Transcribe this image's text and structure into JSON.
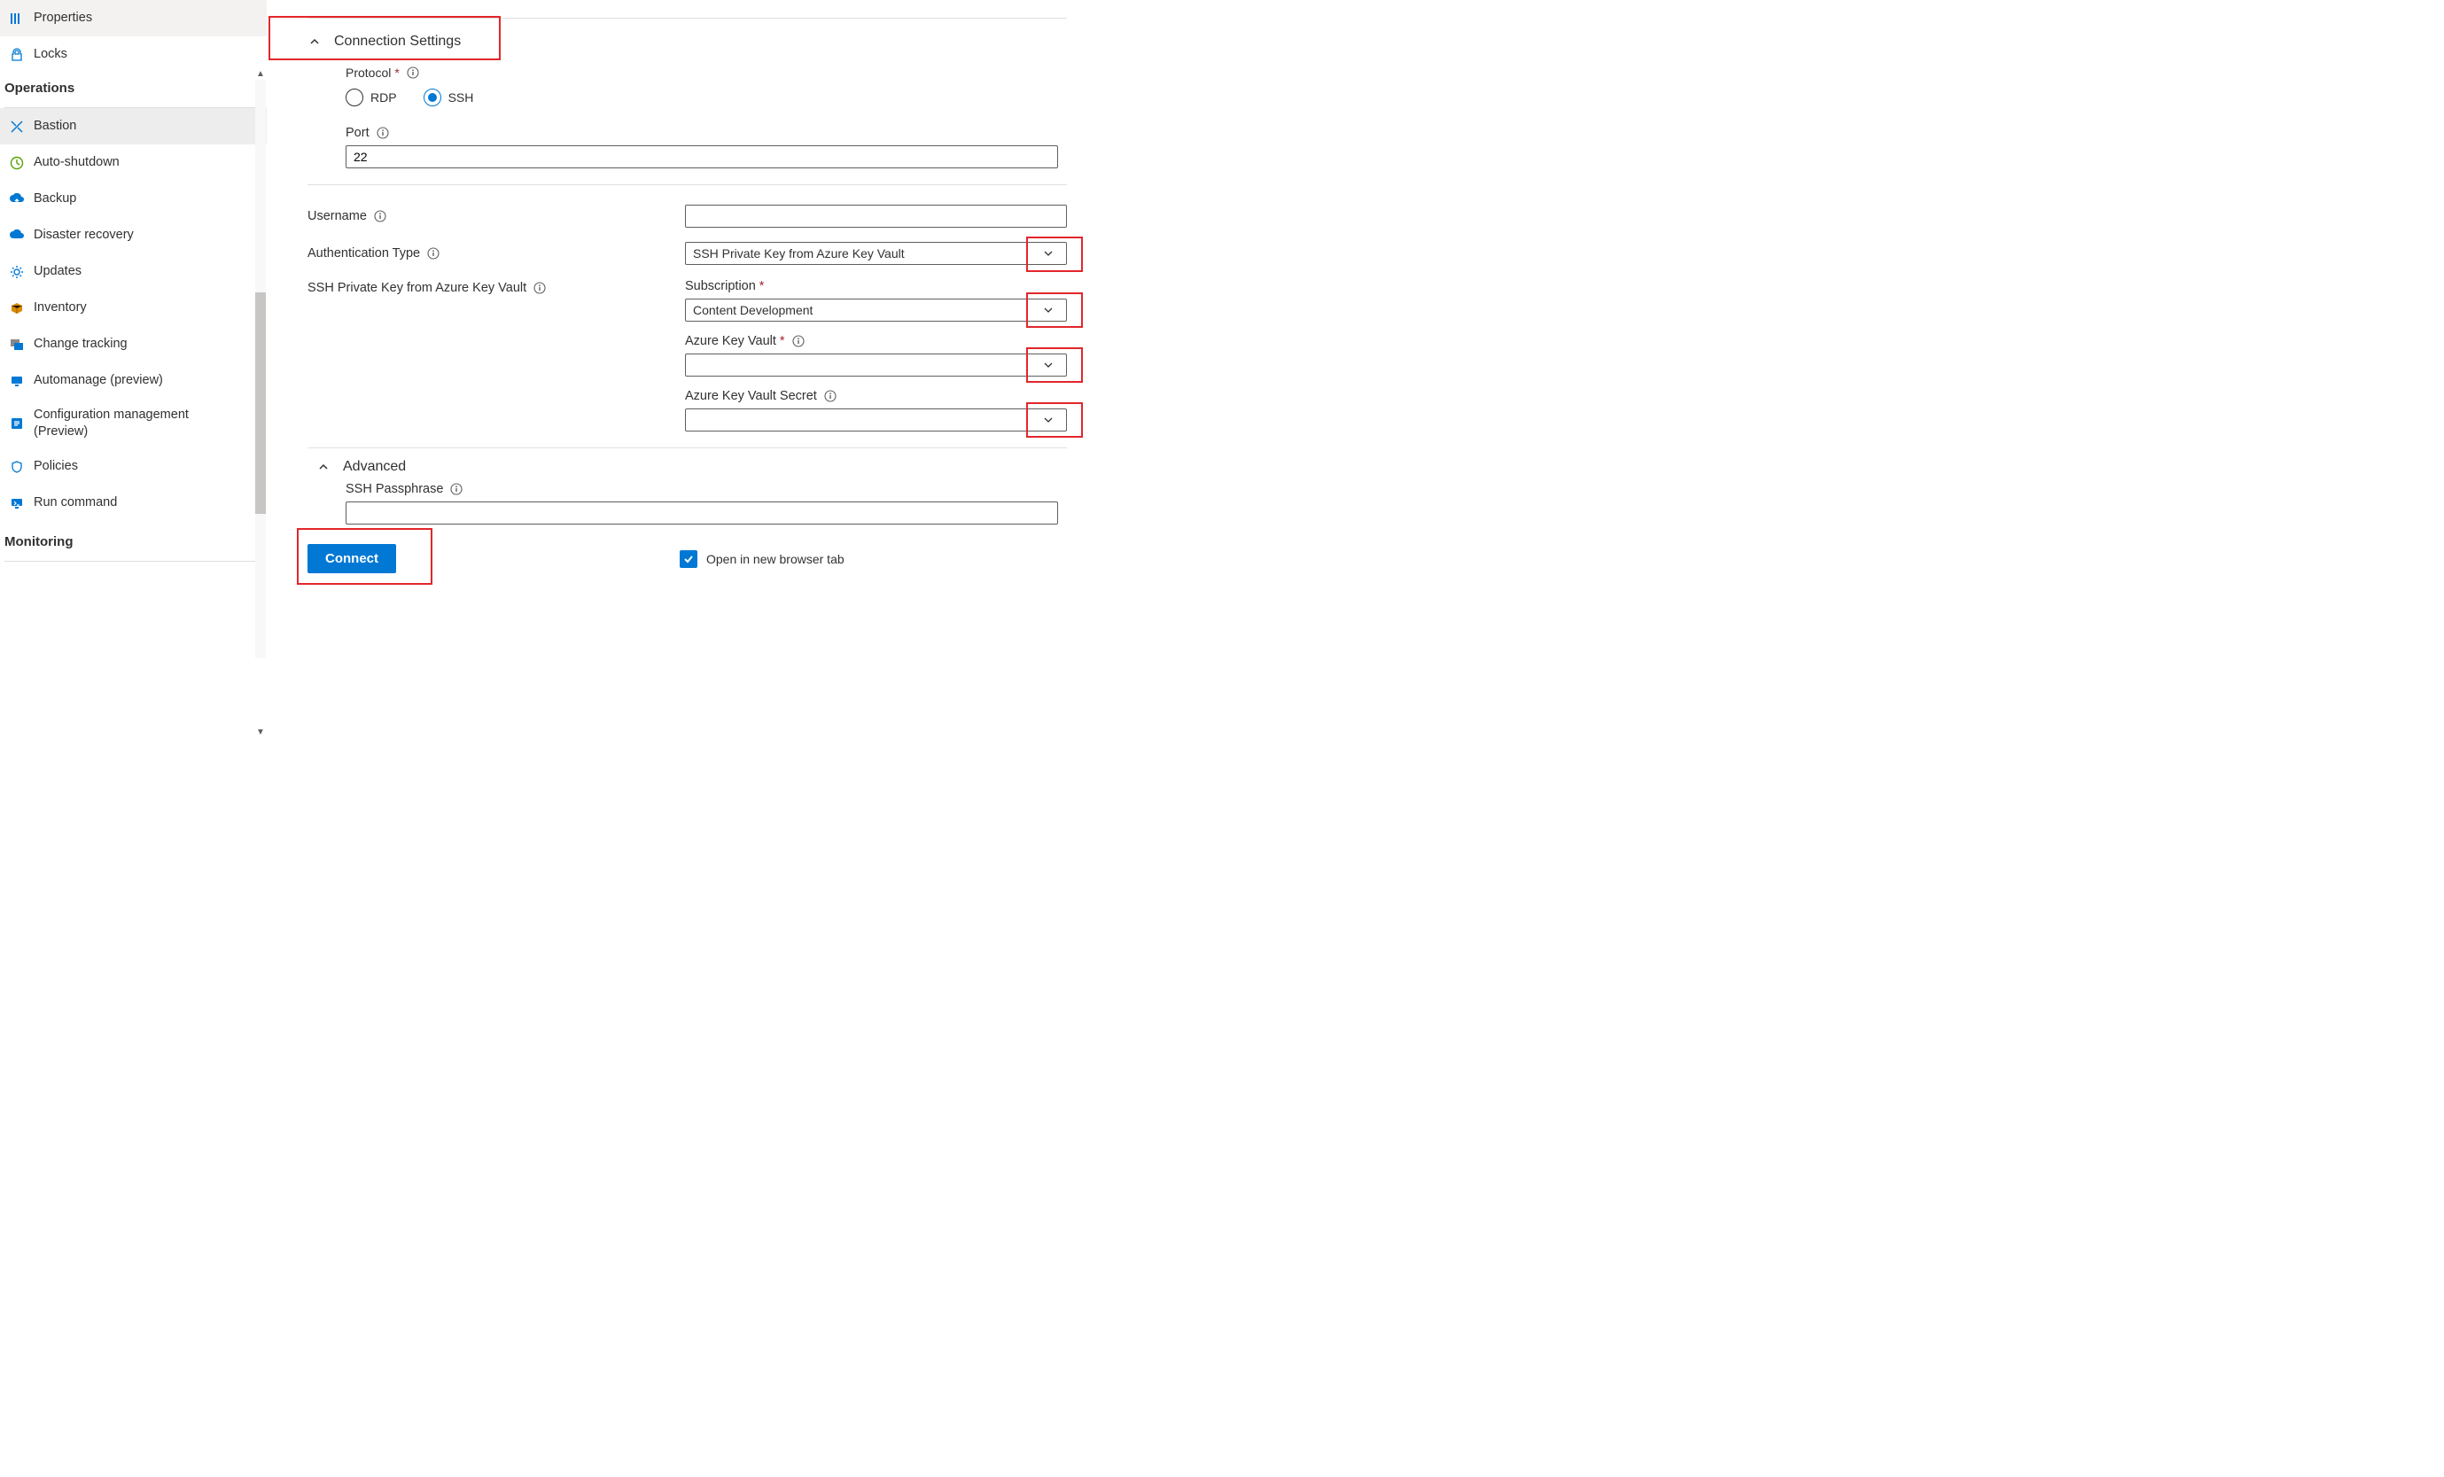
{
  "sidebar": {
    "settings_items": [
      {
        "label": "Properties",
        "icon": "properties"
      },
      {
        "label": "Locks",
        "icon": "lock"
      }
    ],
    "operations_header": "Operations",
    "operations_items": [
      {
        "label": "Bastion",
        "icon": "bastion",
        "selected": true
      },
      {
        "label": "Auto-shutdown",
        "icon": "clock"
      },
      {
        "label": "Backup",
        "icon": "cloud-up"
      },
      {
        "label": "Disaster recovery",
        "icon": "cloud-dr"
      },
      {
        "label": "Updates",
        "icon": "gear"
      },
      {
        "label": "Inventory",
        "icon": "box"
      },
      {
        "label": "Change tracking",
        "icon": "change"
      },
      {
        "label": "Automanage (preview)",
        "icon": "automanage"
      },
      {
        "label": "Configuration management (Preview)",
        "icon": "config"
      },
      {
        "label": "Policies",
        "icon": "policies"
      },
      {
        "label": "Run command",
        "icon": "monitor"
      }
    ],
    "monitoring_header": "Monitoring"
  },
  "main": {
    "connection_settings_title": "Connection Settings",
    "protocol_label": "Protocol",
    "protocol_options": {
      "rdp": "RDP",
      "ssh": "SSH"
    },
    "port_label": "Port",
    "port_value": "22",
    "username_label": "Username",
    "username_value": "",
    "auth_type_label": "Authentication Type",
    "auth_type_value": "SSH Private Key from Azure Key Vault",
    "ssh_kv_label": "SSH Private Key from Azure Key Vault",
    "subscription_label": "Subscription",
    "subscription_value": "Content Development",
    "azure_kv_label": "Azure Key Vault",
    "azure_kv_value": "",
    "azure_kv_secret_label": "Azure Key Vault Secret",
    "azure_kv_secret_value": "",
    "advanced_title": "Advanced",
    "ssh_passphrase_label": "SSH Passphrase",
    "ssh_passphrase_value": "",
    "connect_button": "Connect",
    "open_new_tab_label": "Open in new browser tab"
  }
}
